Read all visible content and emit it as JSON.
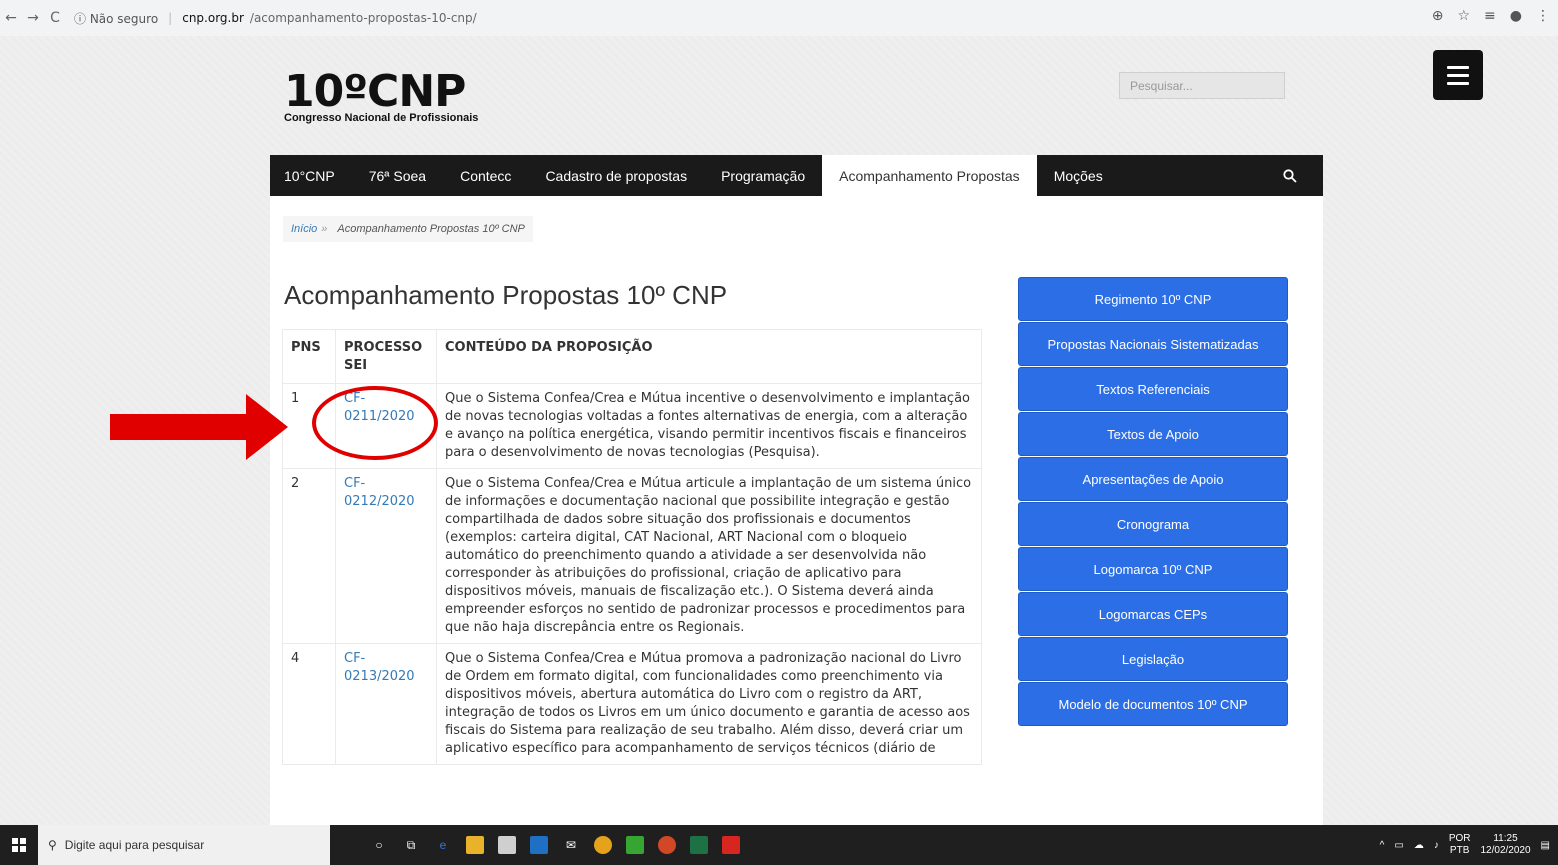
{
  "browser": {
    "nav": {
      "back": "←",
      "forward": "→",
      "reload": "C"
    },
    "security": "ⓘ Não seguro",
    "host": "cnp.org.br",
    "path": "/acompanhamento-propostas-10-cnp/"
  },
  "header": {
    "logo_big": "10ºCNP",
    "logo_sub": "Congresso Nacional de Profissionais",
    "search_placeholder": "Pesquisar..."
  },
  "nav": {
    "items": [
      "10°CNP",
      "76ª Soea",
      "Contecc",
      "Cadastro de propostas",
      "Programação",
      "Acompanhamento Propostas",
      "Moções"
    ],
    "active_index": 5
  },
  "breadcrumb": {
    "home": "Início",
    "sep": "»",
    "current": "Acompanhamento Propostas 10º CNP"
  },
  "page_title": "Acompanhamento Propostas 10º CNP",
  "table": {
    "headers": [
      "PNS",
      "PROCESSO SEI",
      "CONTEÚDO  DA PROPOSIÇÃO"
    ],
    "rows": [
      {
        "pns": "1",
        "sei": "CF-0211/2020",
        "content": "Que o Sistema Confea/Crea e Mútua incentive o desenvolvimento e implantação de novas tecnologias voltadas a fontes alternativas de energia, com a alteração e avanço na política energética, visando permitir incentivos fiscais e financeiros para o desenvolvimento de novas tecnologias (Pesquisa)."
      },
      {
        "pns": "2",
        "sei": "CF-0212/2020",
        "content": "Que o Sistema Confea/Crea e Mútua articule a implantação de um sistema único de informações e documentação nacional que possibilite integração e gestão compartilhada de dados sobre situação dos profissionais e documentos (exemplos: carteira digital, CAT Nacional, ART Nacional com o bloqueio automático do preenchimento quando a atividade a ser desenvolvida não corresponder às atribuições do profissional, criação de aplicativo para dispositivos móveis, manuais de fiscalização etc.). O Sistema deverá ainda empreender esforços no sentido de padronizar processos e procedimentos para que não haja discrepância entre os Regionais."
      },
      {
        "pns": "4",
        "sei": "CF-0213/2020",
        "content": "Que o Sistema Confea/Crea e Mútua promova a padronização nacional do Livro de Ordem em formato digital, com funcionalidades como preenchimento via dispositivos móveis, abertura automática do Livro com o registro da ART, integração de todos os Livros em um único documento e garantia de acesso aos fiscais do Sistema para realização de seu trabalho. Além disso, deverá criar um aplicativo específico para acompanhamento de serviços técnicos (diário de"
      }
    ]
  },
  "sidebar": {
    "buttons": [
      "Regimento 10º CNP",
      "Propostas Nacionais Sistematizadas",
      "Textos Referenciais",
      "Textos de Apoio",
      "Apresentações de Apoio",
      "Cronograma",
      "Logomarca 10º CNP",
      "Logomarcas CEPs",
      "Legislação",
      "Modelo de documentos 10º CNP"
    ]
  },
  "taskbar": {
    "search": "Digite aqui para pesquisar",
    "lang1": "POR",
    "lang2": "PTB",
    "time": "11:25",
    "date": "12/02/2020"
  },
  "colors": {
    "link": "#337ab7",
    "sidebar_button": "#2b6ee5",
    "navbar": "#1a1a1a",
    "annotation": "#e00000"
  }
}
